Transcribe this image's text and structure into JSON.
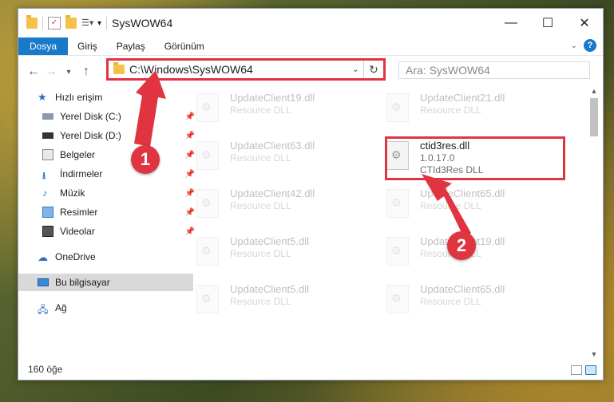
{
  "window": {
    "title": "SysWOW64"
  },
  "ribbon": {
    "tabs": [
      "Dosya",
      "Giriş",
      "Paylaş",
      "Görünüm"
    ],
    "help": "?"
  },
  "address": {
    "path": "C:\\Windows\\SysWOW64",
    "search_placeholder": "Ara: SysWOW64"
  },
  "nav": {
    "items": [
      {
        "label": "Hızlı erişim",
        "icon": "star-icon"
      },
      {
        "label": "Yerel Disk (C:)",
        "icon": "drive-icon",
        "pinned": true
      },
      {
        "label": "Yerel Disk (D:)",
        "icon": "drive-icon",
        "pinned": true
      },
      {
        "label": "Belgeler",
        "icon": "documents-icon",
        "pinned": true
      },
      {
        "label": "İndirmeler",
        "icon": "download-icon",
        "pinned": true
      },
      {
        "label": "Müzik",
        "icon": "music-icon",
        "pinned": true
      },
      {
        "label": "Resimler",
        "icon": "pictures-icon",
        "pinned": true
      },
      {
        "label": "Videolar",
        "icon": "videos-icon",
        "pinned": true
      },
      {
        "label": "OneDrive",
        "icon": "cloud-icon"
      },
      {
        "label": "Bu bilgisayar",
        "icon": "computer-icon",
        "selected": true
      },
      {
        "label": "Ağ",
        "icon": "network-icon"
      }
    ]
  },
  "files": [
    {
      "name": "UpdateClient19.dll",
      "desc": "Resource DLL",
      "faded": true
    },
    {
      "name": "UpdateClient21.dll",
      "desc": "Resource DLL",
      "faded": true
    },
    {
      "name": "UpdateClient63.dll",
      "desc": "Resource DLL",
      "faded": true
    },
    {
      "name": "ctid3res.dll",
      "version": "1.0.17.0",
      "desc": "CTId3Res DLL",
      "faded": false
    },
    {
      "name": "UpdateClient42.dll",
      "desc": "Resource DLL",
      "faded": true
    },
    {
      "name": "UpdateClient65.dll",
      "desc": "Resource DLL",
      "faded": true
    },
    {
      "name": "UpdateClient5.dll",
      "desc": "Resource DLL",
      "faded": true
    },
    {
      "name": "UpdateClient19.dll",
      "desc": "Resource DLL",
      "faded": true
    },
    {
      "name": "UpdateClient5.dll",
      "desc": "Resource DLL",
      "faded": true
    },
    {
      "name": "UpdateClient65.dll",
      "desc": "Resource DLL",
      "faded": true
    }
  ],
  "annotations": {
    "badge1": "1",
    "badge2": "2",
    "color": "#e03440"
  },
  "status": {
    "count": "160 öğe"
  }
}
